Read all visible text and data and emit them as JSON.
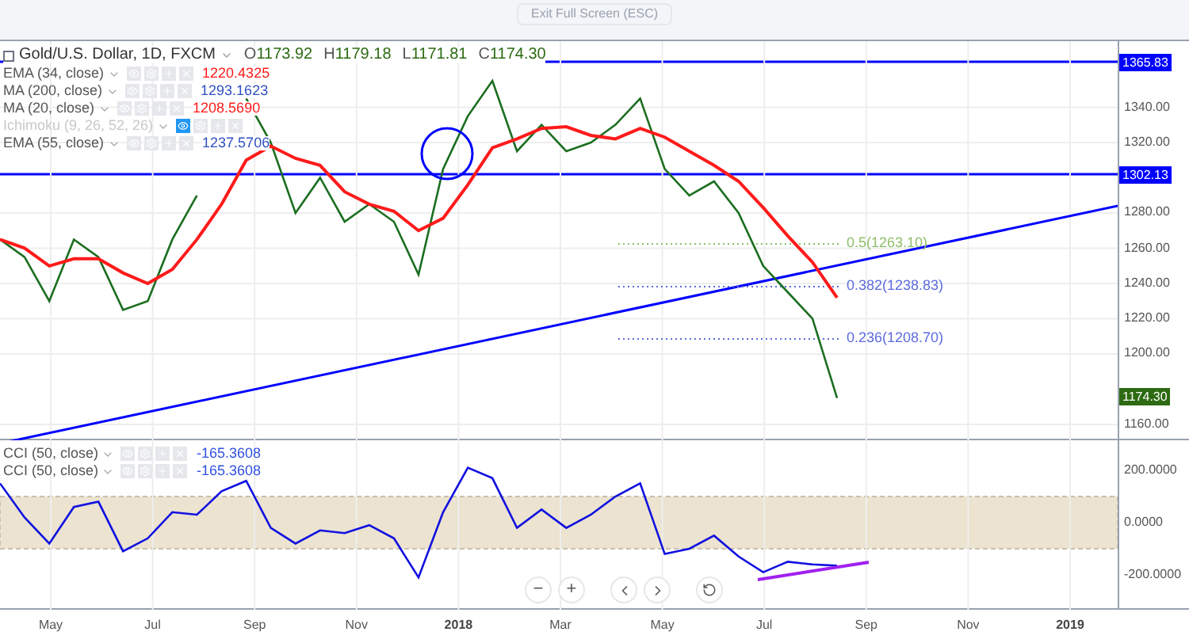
{
  "fullscreen_hint": "Exit Full Screen (ESC)",
  "symbol": {
    "name": "Gold/U.S. Dollar, 1D, FXCM",
    "ohlc": [
      {
        "key": "O",
        "value": "1173.92"
      },
      {
        "key": "H",
        "value": "1179.18"
      },
      {
        "key": "L",
        "value": "1171.81"
      },
      {
        "key": "C",
        "value": "1174.30"
      }
    ]
  },
  "indicators": [
    {
      "name": "EMA (34, close)",
      "value": "1220.4325",
      "color": "#ff1a1a",
      "visible": true
    },
    {
      "name": "MA (200, close)",
      "value": "1293.1623",
      "color": "#3050c0",
      "visible": true
    },
    {
      "name": "MA (20, close)",
      "value": "1208.5690",
      "color": "#ff1a1a",
      "visible": true
    },
    {
      "name": "Ichimoku (9, 26, 52, 26)",
      "visible": false
    },
    {
      "name": "EMA (55, close)",
      "value": "1237.5706",
      "color": "#3050c0",
      "visible": true
    }
  ],
  "price_chart": {
    "chart_data": {
      "type": "line",
      "series": [
        {
          "color": "#1b6e20",
          "values": [
            1265,
            1255,
            1230,
            1265,
            1255,
            1225,
            1230,
            1265,
            1290,
            null,
            1345,
            1320,
            1280,
            1300,
            1275,
            1285,
            1275,
            1245,
            1305,
            1335,
            1355,
            1315,
            1330,
            1315,
            1320,
            1330,
            1345,
            1305,
            1290,
            1298,
            1280,
            1250,
            1235,
            1220,
            1175
          ]
        },
        {
          "color": "#ff1a1a",
          "values": [
            1265,
            1260,
            1250,
            1254,
            1254,
            1246,
            1240,
            1248,
            1265,
            1285,
            1310,
            1318,
            1311,
            1307,
            1292,
            1285,
            1281,
            1270,
            1277,
            1296,
            1317,
            1322,
            1328,
            1329,
            1324,
            1322,
            1328,
            1323,
            1315,
            1307,
            1298,
            1283,
            1267,
            1252,
            1232
          ]
        }
      ],
      "ylim": [
        1151,
        1377.5
      ],
      "grid": true,
      "yticks": [
        {
          "value": 1160,
          "label": "1160.00"
        },
        {
          "value": 1200,
          "label": "1200.00"
        },
        {
          "value": 1220,
          "label": "1220.00"
        },
        {
          "value": 1240,
          "label": "1240.00"
        },
        {
          "value": 1260,
          "label": "1260.00"
        },
        {
          "value": 1280,
          "label": "1280.00"
        },
        {
          "value": 1320,
          "label": "1320.00"
        },
        {
          "value": 1340,
          "label": "1340.00"
        }
      ]
    },
    "price_tags": [
      {
        "label": "1365.83",
        "color": "#0000ff"
      },
      {
        "label": "1302.13",
        "color": "#0000ff"
      }
    ],
    "last_price": {
      "label": "1174.30",
      "color": "#2d6a12"
    },
    "fib_levels": [
      {
        "label": "0.5(1263.10)",
        "color": "#8fbf6a"
      },
      {
        "label": "0.382(1238.83)",
        "color": "#5c6bdf"
      },
      {
        "label": "0.236(1208.70)",
        "color": "#5c6bdf"
      }
    ]
  },
  "cci_pane": {
    "legend": [
      {
        "name": "CCI (50, close)",
        "value": "-165.3608"
      },
      {
        "name": "CCI (50, close)",
        "value": "-165.3608"
      }
    ],
    "chart_data": {
      "type": "line",
      "grid": true,
      "series": [
        {
          "color": "#1010e0",
          "values": [
            150,
            20,
            -80,
            60,
            80,
            -110,
            -60,
            40,
            30,
            120,
            160,
            -20,
            -80,
            -30,
            -40,
            -10,
            -60,
            -210,
            40,
            210,
            170,
            -20,
            50,
            -20,
            30,
            100,
            150,
            -120,
            -100,
            -50,
            -130,
            -190,
            -150,
            -160,
            -165
          ]
        }
      ],
      "ylim": [
        -333.5,
        315
      ],
      "yticks": [
        {
          "value": 200,
          "label": "200.0000"
        },
        {
          "value": 0,
          "label": "0.0000"
        },
        {
          "value": -200,
          "label": "-200.0000"
        }
      ]
    }
  },
  "zoom_controls": [
    "−",
    "+"
  ],
  "time_axis": [
    {
      "label": "May",
      "kind": "month"
    },
    {
      "label": "Jul",
      "kind": "month"
    },
    {
      "label": "Sep",
      "kind": "month"
    },
    {
      "label": "Nov",
      "kind": "month"
    },
    {
      "label": "2018",
      "kind": "year"
    },
    {
      "label": "Mar",
      "kind": "month"
    },
    {
      "label": "May",
      "kind": "month"
    },
    {
      "label": "Jul",
      "kind": "month"
    },
    {
      "label": "Sep",
      "kind": "month"
    },
    {
      "label": "Nov",
      "kind": "month"
    },
    {
      "label": "2019",
      "kind": "year"
    }
  ]
}
